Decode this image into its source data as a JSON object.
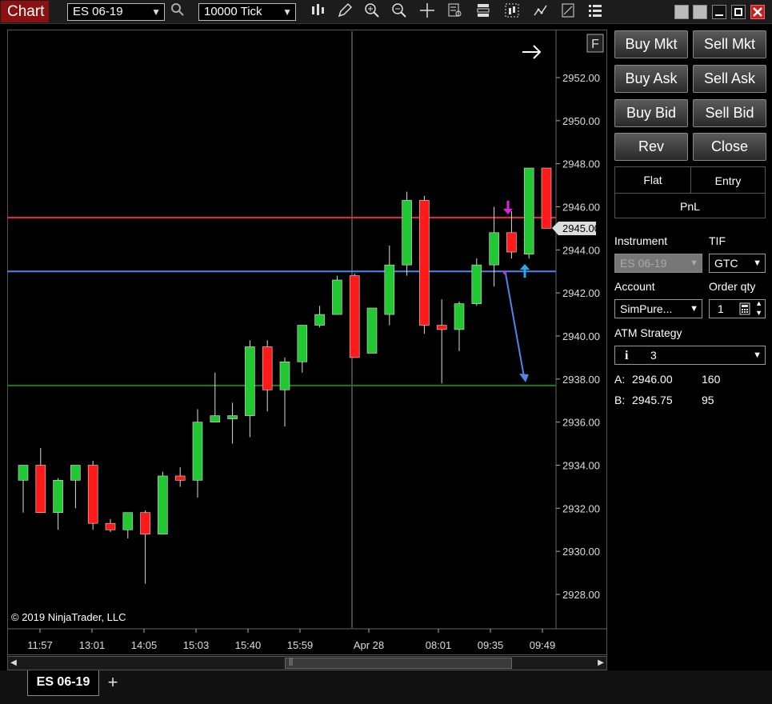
{
  "toolbar": {
    "app_title": "Chart",
    "instrument": "ES 06-19",
    "interval": "10000 Tick",
    "tools": [
      "bar-type-icon",
      "pencil-icon",
      "zoom-in-icon",
      "zoom-out-icon",
      "crosshair-icon",
      "data-box-icon",
      "properties-icon",
      "strategies-icon",
      "indicators-icon",
      "drawing-tools-icon",
      "order-panel-icon"
    ]
  },
  "chart": {
    "copyright": "© 2019 NinjaTrader, LLC",
    "f_label": "F",
    "price_tag": "2945.00",
    "y_ticks": [
      "2952.00",
      "2950.00",
      "2948.00",
      "2946.00",
      "2944.00",
      "2942.00",
      "2940.00",
      "2938.00",
      "2936.00",
      "2934.00",
      "2932.00",
      "2930.00",
      "2928.00"
    ],
    "x_ticks": [
      "11:57",
      "13:01",
      "14:05",
      "15:03",
      "15:40",
      "15:59",
      "Apr 28",
      "08:01",
      "09:35",
      "09:49"
    ],
    "colors": {
      "up": "#22c832",
      "down": "#ff1a1a",
      "red_line": "#e8262a",
      "blue_line": "#4f86e8",
      "green_line": "#1b7a2a",
      "magenta": "#e020e0",
      "cyan_arrow": "#2aa8f0"
    }
  },
  "chart_data": {
    "type": "candlestick",
    "ylim": [
      2926.5,
      2954
    ],
    "series": [
      {
        "o": 2933.3,
        "h": 2934.0,
        "l": 2931.8,
        "c": 2934.0
      },
      {
        "o": 2934.0,
        "h": 2934.8,
        "l": 2931.8,
        "c": 2931.8
      },
      {
        "o": 2931.8,
        "h": 2933.4,
        "l": 2931.0,
        "c": 2933.3
      },
      {
        "o": 2933.3,
        "h": 2934.0,
        "l": 2932.0,
        "c": 2934.0
      },
      {
        "o": 2934.0,
        "h": 2934.2,
        "l": 2931.0,
        "c": 2931.3
      },
      {
        "o": 2931.3,
        "h": 2931.5,
        "l": 2930.9,
        "c": 2931.0
      },
      {
        "o": 2931.0,
        "h": 2931.8,
        "l": 2930.6,
        "c": 2931.8
      },
      {
        "o": 2931.8,
        "h": 2931.9,
        "l": 2928.5,
        "c": 2930.8
      },
      {
        "o": 2930.8,
        "h": 2933.7,
        "l": 2930.8,
        "c": 2933.5
      },
      {
        "o": 2933.5,
        "h": 2933.9,
        "l": 2933.0,
        "c": 2933.3
      },
      {
        "o": 2933.3,
        "h": 2936.6,
        "l": 2932.5,
        "c": 2936.0
      },
      {
        "o": 2936.0,
        "h": 2938.3,
        "l": 2936.0,
        "c": 2936.3
      },
      {
        "o": 2936.3,
        "h": 2936.9,
        "l": 2935.0,
        "c": 2936.3
      },
      {
        "o": 2936.3,
        "h": 2939.8,
        "l": 2935.3,
        "c": 2939.5
      },
      {
        "o": 2939.5,
        "h": 2939.8,
        "l": 2936.5,
        "c": 2937.5
      },
      {
        "o": 2937.5,
        "h": 2939.0,
        "l": 2935.8,
        "c": 2938.8
      },
      {
        "o": 2938.8,
        "h": 2940.5,
        "l": 2938.3,
        "c": 2940.5
      },
      {
        "o": 2940.5,
        "h": 2941.4,
        "l": 2940.4,
        "c": 2941.0
      },
      {
        "o": 2941.0,
        "h": 2942.8,
        "l": 2941.0,
        "c": 2942.6
      },
      {
        "o": 2942.8,
        "h": 2942.9,
        "l": 2939.2,
        "c": 2939.0
      },
      {
        "o": 2939.2,
        "h": 2941.3,
        "l": 2939.2,
        "c": 2941.3
      },
      {
        "o": 2941.0,
        "h": 2944.2,
        "l": 2940.5,
        "c": 2943.3
      },
      {
        "o": 2943.3,
        "h": 2946.7,
        "l": 2942.8,
        "c": 2946.3
      },
      {
        "o": 2946.3,
        "h": 2946.5,
        "l": 2940.1,
        "c": 2940.5
      },
      {
        "o": 2940.5,
        "h": 2941.7,
        "l": 2937.8,
        "c": 2940.3
      },
      {
        "o": 2940.3,
        "h": 2941.6,
        "l": 2939.3,
        "c": 2941.5
      },
      {
        "o": 2941.5,
        "h": 2943.6,
        "l": 2941.4,
        "c": 2943.3
      },
      {
        "o": 2943.3,
        "h": 2946.0,
        "l": 2942.3,
        "c": 2944.8
      },
      {
        "o": 2944.8,
        "h": 2945.8,
        "l": 2943.6,
        "c": 2943.9
      },
      {
        "o": 2943.8,
        "h": 2947.8,
        "l": 2943.6,
        "c": 2947.8
      },
      {
        "o": 2947.8,
        "h": 2947.8,
        "l": 2945.0,
        "c": 2945.0
      }
    ],
    "horizontal_lines": [
      2945.5,
      2943.0,
      2937.7
    ]
  },
  "order_panel": {
    "buttons": [
      "Buy Mkt",
      "Sell Mkt",
      "Buy Ask",
      "Sell Ask",
      "Buy Bid",
      "Sell Bid",
      "Rev",
      "Close"
    ],
    "position": {
      "flat": "Flat",
      "entry": "Entry",
      "pnl": "PnL"
    },
    "instrument_label": "Instrument",
    "instrument_value": "ES 06-19",
    "tif_label": "TIF",
    "tif_value": "GTC",
    "account_label": "Account",
    "account_value": "SimPure...",
    "qty_label": "Order qty",
    "qty_value": "1",
    "atm_label": "ATM Strategy",
    "atm_value": "3",
    "ask_label": "A:",
    "ask_price": "2946.00",
    "ask_size": "160",
    "bid_label": "B:",
    "bid_price": "2945.75",
    "bid_size": "95"
  },
  "tabs": {
    "active": "ES 06-19",
    "add": "+"
  }
}
